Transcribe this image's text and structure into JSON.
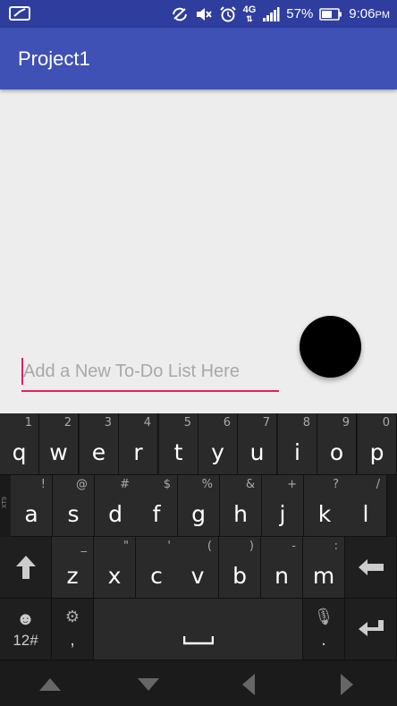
{
  "status_bar": {
    "battery_percent": "57%",
    "time": "9:06",
    "time_suffix": "PM",
    "network": "4G"
  },
  "app_bar": {
    "title": "Project1"
  },
  "todo_input": {
    "placeholder": "Add a New To-Do List Here",
    "value": ""
  },
  "keyboard": {
    "row1": [
      {
        "key": "q",
        "hint": "1"
      },
      {
        "key": "w",
        "hint": "2"
      },
      {
        "key": "e",
        "hint": "3"
      },
      {
        "key": "r",
        "hint": "4"
      },
      {
        "key": "t",
        "hint": "5"
      },
      {
        "key": "y",
        "hint": "6"
      },
      {
        "key": "u",
        "hint": "7"
      },
      {
        "key": "i",
        "hint": "8"
      },
      {
        "key": "o",
        "hint": "9"
      },
      {
        "key": "p",
        "hint": "0"
      }
    ],
    "row2": [
      {
        "key": "a",
        "hint": "!"
      },
      {
        "key": "s",
        "hint": "@"
      },
      {
        "key": "d",
        "hint": "#"
      },
      {
        "key": "f",
        "hint": "$"
      },
      {
        "key": "g",
        "hint": "%"
      },
      {
        "key": "h",
        "hint": "&"
      },
      {
        "key": "j",
        "hint": "+"
      },
      {
        "key": "k",
        "hint": "?"
      },
      {
        "key": "l",
        "hint": "/"
      }
    ],
    "row3": [
      {
        "key": "z",
        "hint": "_"
      },
      {
        "key": "x",
        "hint": "\""
      },
      {
        "key": "c",
        "hint": "'"
      },
      {
        "key": "v",
        "hint": "("
      },
      {
        "key": "b",
        "hint": ")"
      },
      {
        "key": "n",
        "hint": "-"
      },
      {
        "key": "m",
        "hint": ":"
      }
    ],
    "symbols_label": "12#",
    "comma_label": ",",
    "period_label": ".",
    "side_label": "XT9"
  }
}
